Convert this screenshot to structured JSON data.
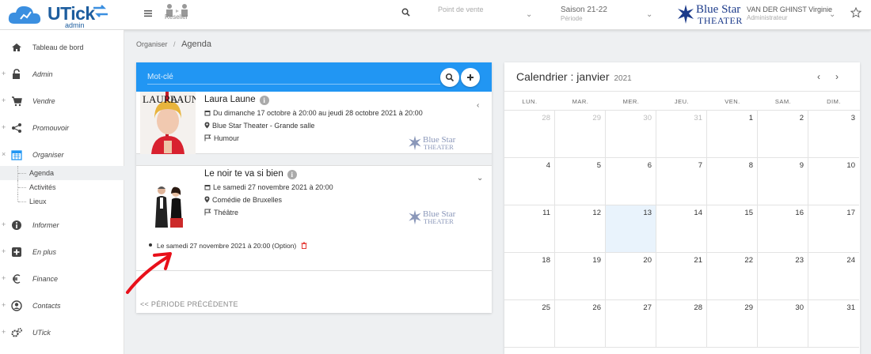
{
  "header": {
    "logo_title": "UTick",
    "logo_sub": "admin",
    "reseller_label": "Reseller",
    "point_de_vente_placeholder": "Point de vente",
    "season_value": "Saison 21-22",
    "season_label": "Période",
    "venue_logo_line1": "Blue Star",
    "venue_logo_line2": "THEATER",
    "user_name": "VAN DER GHINST Virginie",
    "user_role": "Administrateur"
  },
  "sidebar": {
    "items": [
      {
        "label": "Tableau de bord",
        "icon": "home-icon",
        "prefix": ""
      },
      {
        "label": "Admin",
        "icon": "unlock-icon",
        "prefix": "+"
      },
      {
        "label": "Vendre",
        "icon": "cart-icon",
        "prefix": "+"
      },
      {
        "label": "Promouvoir",
        "icon": "share-icon",
        "prefix": "+"
      },
      {
        "label": "Organiser",
        "icon": "calendar-icon",
        "prefix": "×"
      },
      {
        "label": "Informer",
        "icon": "info-icon",
        "prefix": "+"
      },
      {
        "label": "En plus",
        "icon": "plus-square-icon",
        "prefix": "+"
      },
      {
        "label": "Finance",
        "icon": "euro-icon",
        "prefix": "+"
      },
      {
        "label": "Contacts",
        "icon": "user-circle-icon",
        "prefix": "+"
      },
      {
        "label": "UTick",
        "icon": "cogs-icon",
        "prefix": "+"
      }
    ],
    "subitems": [
      {
        "label": "Agenda",
        "active": true
      },
      {
        "label": "Activités",
        "active": false
      },
      {
        "label": "Lieux",
        "active": false
      }
    ]
  },
  "breadcrumb": {
    "parent": "Organiser",
    "separator": "/",
    "current": "Agenda"
  },
  "agenda": {
    "search_placeholder": "Mot-clé",
    "poster1_text_a": "LAURA",
    "poster1_text_b": "LAUNE",
    "events": [
      {
        "title": "Laura Laune",
        "dates": "Du dimanche 17 octobre à 20:00 au jeudi 28 octobre 2021 à 20:00",
        "venue": "Blue Star Theater - Grande salle",
        "category": "Humour",
        "toggle": "‹"
      },
      {
        "title": "Le noir te va si bien",
        "dates": "Le samedi 27 novembre 2021 à 20:00",
        "venue": "Comédie de Bruxelles",
        "category": "Théâtre",
        "toggle": "⌄"
      }
    ],
    "session": "Le samedi 27 novembre 2021 à 20:00 (Option)",
    "previous_period": "<< PÉRIODE PRÉCÉDENTE"
  },
  "calendar": {
    "title": "Calendrier : janvier",
    "year": "2021",
    "prev": "‹",
    "next": "›",
    "weekdays": [
      "LUN.",
      "MAR.",
      "MER.",
      "JEU.",
      "VEN.",
      "SAM.",
      "DIM."
    ],
    "weeks": [
      [
        "28",
        "29",
        "30",
        "31",
        "1",
        "2",
        "3"
      ],
      [
        "4",
        "5",
        "6",
        "7",
        "8",
        "9",
        "10"
      ],
      [
        "11",
        "12",
        "13",
        "14",
        "15",
        "16",
        "17"
      ],
      [
        "18",
        "19",
        "20",
        "21",
        "22",
        "23",
        "24"
      ],
      [
        "25",
        "26",
        "27",
        "28",
        "29",
        "30",
        "31"
      ]
    ],
    "other_month_cells": [
      "0-0",
      "0-1",
      "0-2",
      "0-3"
    ],
    "today_cell": "2-2"
  },
  "colors": {
    "accent": "#2196f3",
    "brand": "#1d5d9e",
    "venue_logo": "#1b3a8a",
    "annotation": "#e8101a"
  }
}
